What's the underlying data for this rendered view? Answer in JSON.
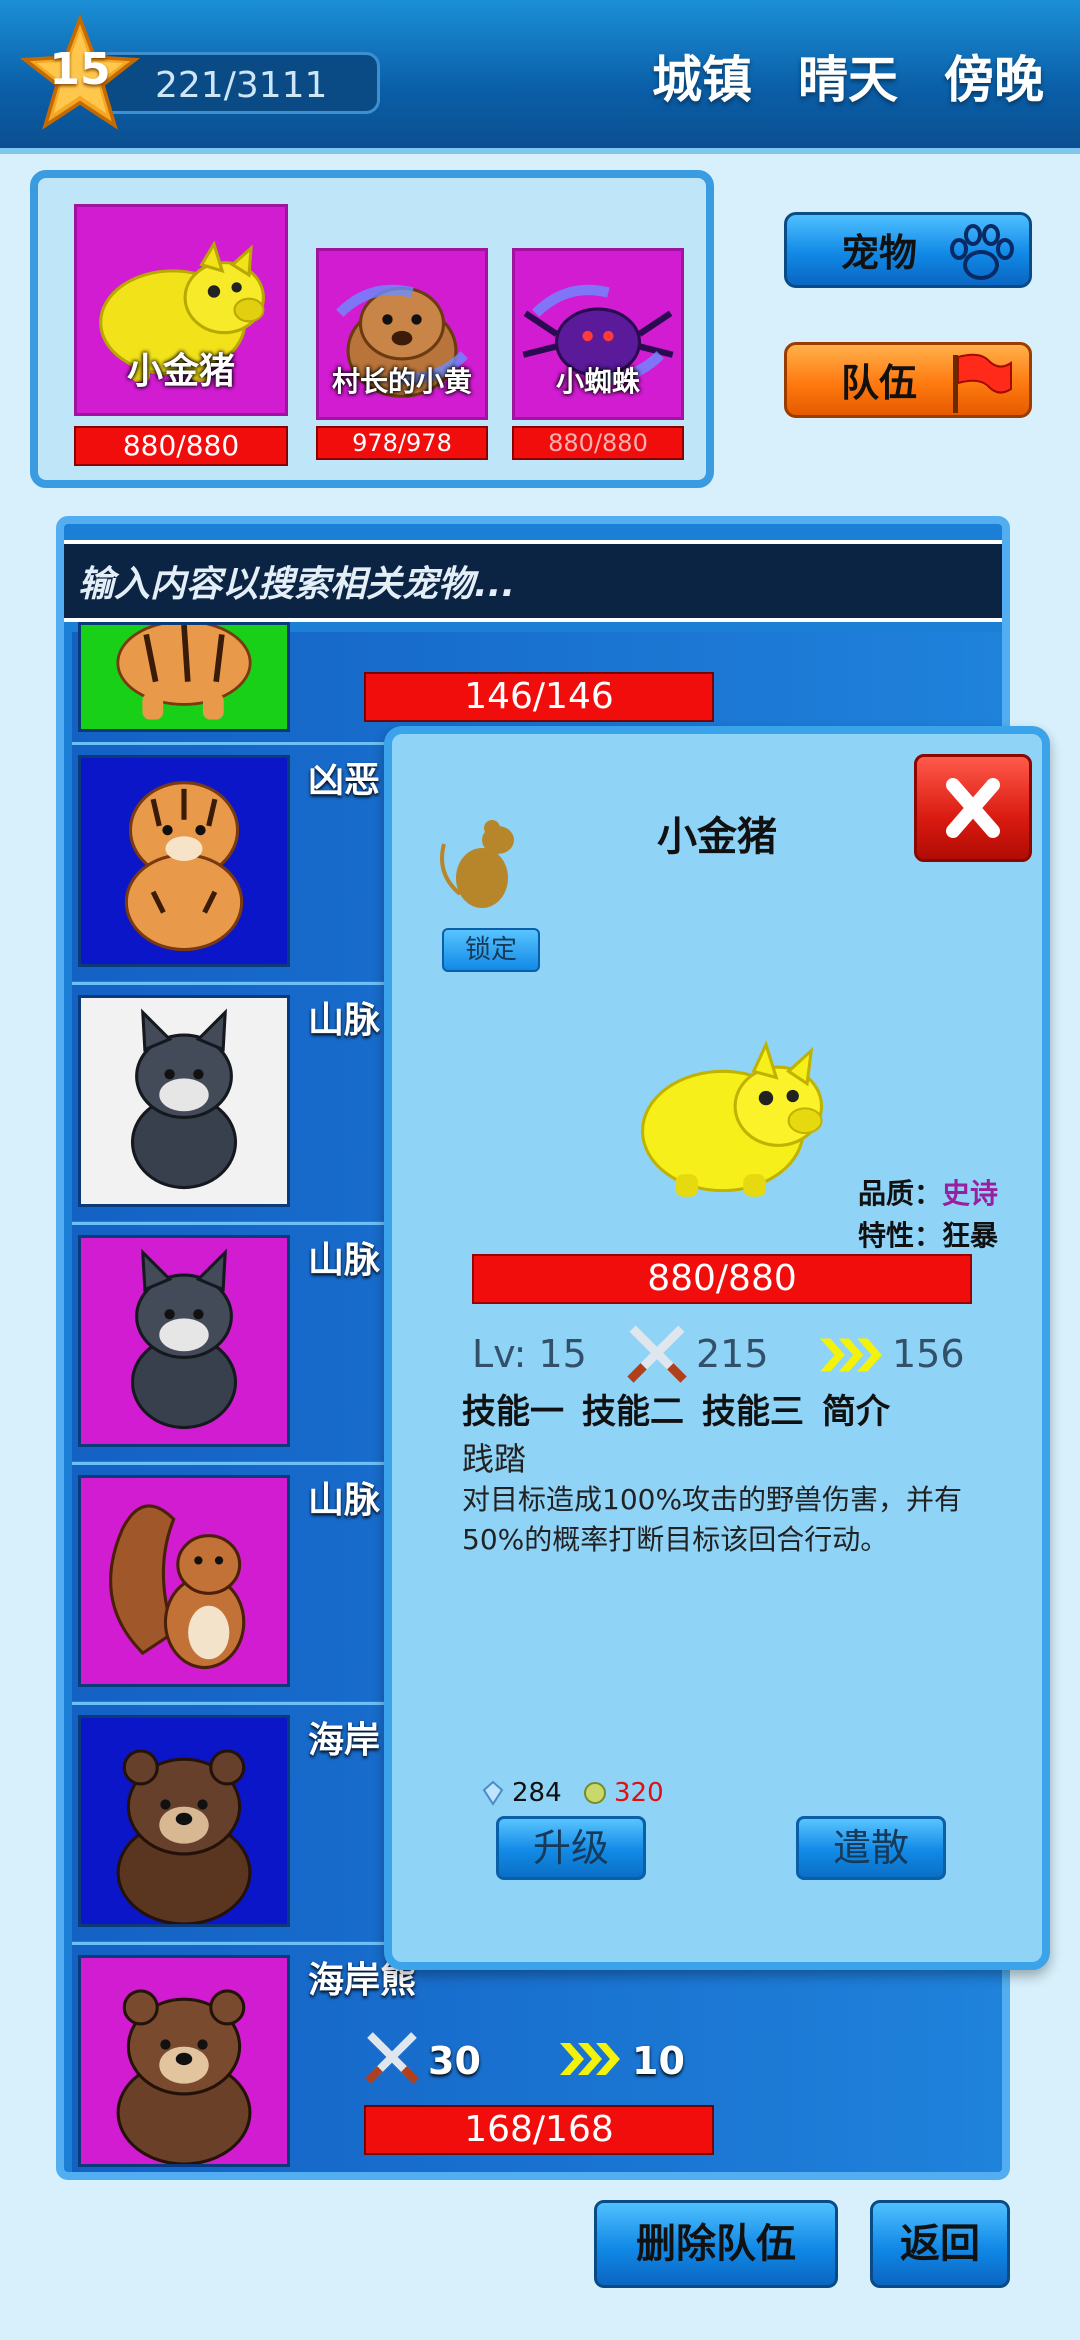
{
  "header": {
    "level": "15",
    "xp": "221/3111",
    "location": "城镇",
    "weather": "晴天",
    "time_of_day": "傍晚"
  },
  "team": [
    {
      "name": "小金猪",
      "hp": "880/880",
      "icon": "gold-pig-icon"
    },
    {
      "name": "村长的小黄",
      "hp": "978/978",
      "icon": "dog-icon"
    },
    {
      "name": "小蜘蛛",
      "hp": "880/880",
      "icon": "spider-icon"
    }
  ],
  "side_buttons": {
    "pet": "宠物",
    "team": "队伍"
  },
  "search": {
    "placeholder": "输入内容以搜索相关宠物..."
  },
  "pet_list": [
    {
      "name": "",
      "attack": "",
      "speed": "",
      "hp": "146/146",
      "bg": "#19d019",
      "icon": "tiger-icon"
    },
    {
      "name": "凶恶",
      "hp": "",
      "bg": "#0b16c8",
      "icon": "tiger-icon"
    },
    {
      "name": "山脉",
      "hp": "",
      "bg": "#f2f2f2",
      "icon": "wolf-icon"
    },
    {
      "name": "山脉",
      "hp": "",
      "bg": "#d11cd1",
      "icon": "wolf-icon"
    },
    {
      "name": "山脉",
      "hp": "",
      "bg": "#d11cd1",
      "icon": "squirrel-icon"
    },
    {
      "name": "海岸",
      "hp": "",
      "bg": "#0b16c8",
      "icon": "bear-icon"
    },
    {
      "name": "海岸熊",
      "attack": "30",
      "speed": "10",
      "hp": "168/168",
      "bg": "#d11cd1",
      "icon": "bear-icon"
    }
  ],
  "detail": {
    "name": "小金猪",
    "lock_label": "锁定",
    "quality_label": "品质：",
    "quality": "史诗",
    "quality_color": "#9a1fa0",
    "trait_label": "特性：",
    "trait": "狂暴",
    "hp": "880/880",
    "level": "Lv: 15",
    "attack": "215",
    "speed": "156",
    "tabs": [
      "技能一",
      "技能二",
      "技能三",
      "简介"
    ],
    "skill_name": "践踏",
    "skill_desc": "对目标造成100%攻击的野兽伤害，并有50%的概率打断目标该回合行动。",
    "cost_crystal": "284",
    "cost_coin": "320",
    "upgrade_label": "升级",
    "dismiss_label": "遣散"
  },
  "bottom": {
    "remove_team": "删除队伍",
    "back": "返回"
  }
}
